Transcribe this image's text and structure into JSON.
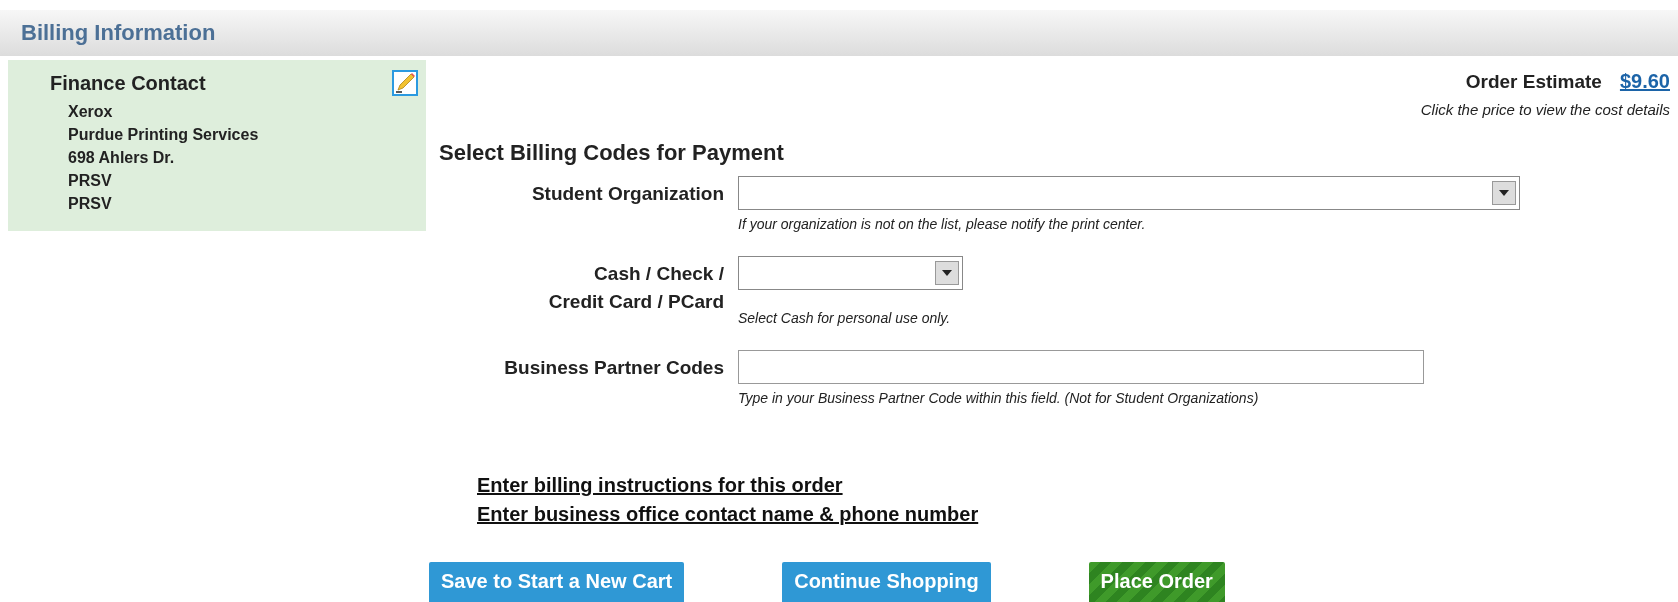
{
  "section": {
    "title": "Billing Information"
  },
  "finance_contact": {
    "title": "Finance Contact",
    "lines": [
      "Xerox",
      "Purdue Printing Services",
      "698 Ahlers Dr.",
      "PRSV",
      "PRSV"
    ]
  },
  "estimate": {
    "label": "Order Estimate",
    "price": "$9.60",
    "note": "Click the price to view the cost details"
  },
  "billing": {
    "heading": "Select Billing Codes for Payment",
    "fields": [
      {
        "kind": "select",
        "label": [
          "Student Organization"
        ],
        "hint": "If your organization is not on the list, please notify the print center."
      },
      {
        "kind": "select",
        "label": [
          "Cash / Check /",
          "Credit Card / PCard"
        ],
        "hint": "Select Cash for personal use only."
      },
      {
        "kind": "text",
        "label": [
          "Business Partner Codes"
        ],
        "hint": "Type in your Business Partner Code within this field. (Not for Student Organizations)"
      }
    ]
  },
  "links": [
    "Enter billing instructions for this order",
    "Enter business office contact name & phone number"
  ],
  "buttons": [
    {
      "label": "Save to Start a New Cart",
      "kind": "secondary"
    },
    {
      "label": "Continue Shopping",
      "kind": "secondary"
    },
    {
      "label": "Place Order",
      "kind": "primary"
    }
  ]
}
